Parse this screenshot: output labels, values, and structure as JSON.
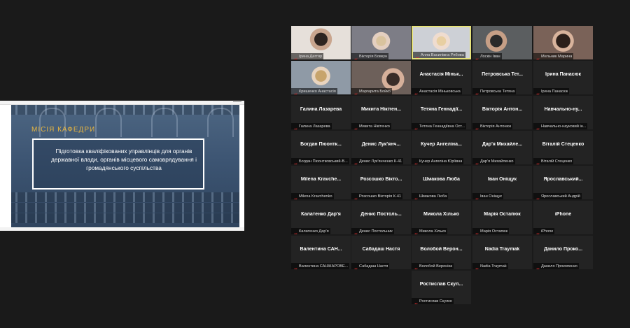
{
  "slide": {
    "title": "МІСІЯ   КАФЕДРИ",
    "text": "Підготовка кваліфікованих управлінців для органів державної влади, органів місцевого самоврядування і громадянського суспільства"
  },
  "participants": [
    {
      "big": "",
      "label": "Ірина Дегтяр",
      "video": "v1"
    },
    {
      "big": "",
      "label": "Вікторія Бовкун",
      "video": "v2"
    },
    {
      "big": "",
      "label": "Алла Василівна Рябова",
      "video": "v3",
      "active": true
    },
    {
      "big": "",
      "label": "Лоскін Іван",
      "video": "v4"
    },
    {
      "big": "",
      "label": "Мельник Марина",
      "video": "v5"
    },
    {
      "big": "",
      "label": "Кришенко Анастасія",
      "video": "v6"
    },
    {
      "big": "",
      "label": "Маргарита Бойко",
      "video": "v7"
    },
    {
      "big": "Анастасія Міньк...",
      "label": "Анастасія Міньковська"
    },
    {
      "big": "Петровська Тет...",
      "label": "Петровська Тетяна"
    },
    {
      "big": "Ірина Панасюк",
      "label": "Ірина Панасюк"
    },
    {
      "big": "Галина Лазарева",
      "label": "Галина Лазарева"
    },
    {
      "big": "Микита Нікітен...",
      "label": "Микита Нікітенко"
    },
    {
      "big": "Тетяна Геннадії...",
      "label": "Тетяна Геннадіївна Ост..."
    },
    {
      "big": "Вікторія Антон...",
      "label": "Вікторія Антонюк"
    },
    {
      "big": "Навчально-ну...",
      "label": "Навчально-науковий ін..."
    },
    {
      "big": "Богдан Пюонтк...",
      "label": "Богдан Пюонтковський-В..."
    },
    {
      "big": "Денис Лук'янч...",
      "label": "Денис Лук'янченко К-41"
    },
    {
      "big": "Кучер Ангеліна...",
      "label": "Кучер Ангеліна Юріївна"
    },
    {
      "big": "Дар'я Михайле...",
      "label": "Дар'я Михайленко"
    },
    {
      "big": "Віталій Стеценко",
      "label": "Віталій Стеценко"
    },
    {
      "big": "Milena Kravche...",
      "label": "Milena Kravchenko"
    },
    {
      "big": "Розсошко Вікто...",
      "label": "Розсошко Вікторія К-41"
    },
    {
      "big": "Шмакова Люба",
      "label": "Шмакова Люба"
    },
    {
      "big": "Іван Оніщук",
      "label": "Іван Оніщук"
    },
    {
      "big": "Ярославський...",
      "label": "Ярославський Андрій"
    },
    {
      "big": "Калатенко Дар'я",
      "label": "Калатенко Дар'я"
    },
    {
      "big": "Денис Постоль...",
      "label": "Денис Постольник"
    },
    {
      "big": "Микола Хілько",
      "label": "Микола Хілько"
    },
    {
      "big": "Марія Остапюк",
      "label": "Марія Остапюк"
    },
    {
      "big": "iPhone",
      "label": "iPhone"
    },
    {
      "big": "Валентина САН...",
      "label": "Валентина САНЖАРОВЕ..."
    },
    {
      "big": "Сабадаш Настя",
      "label": "Сабадаш Настя"
    },
    {
      "big": "Волобой Верон...",
      "label": "Волобой Вероніка"
    },
    {
      "big": "Nadia Traymak",
      "label": "Nadia Traymak"
    },
    {
      "big": "Данило Проко...",
      "label": "Данило Прокопенко"
    },
    {
      "big": "",
      "label": "",
      "hidden": true
    },
    {
      "big": "",
      "label": "",
      "hidden": true
    },
    {
      "big": "Ростислав Скул...",
      "label": "Ростислав Скулко"
    }
  ],
  "colors": {
    "active_border": "#e6e27a",
    "mic_muted": "#e02c2c",
    "slide_title": "#e8b640"
  }
}
